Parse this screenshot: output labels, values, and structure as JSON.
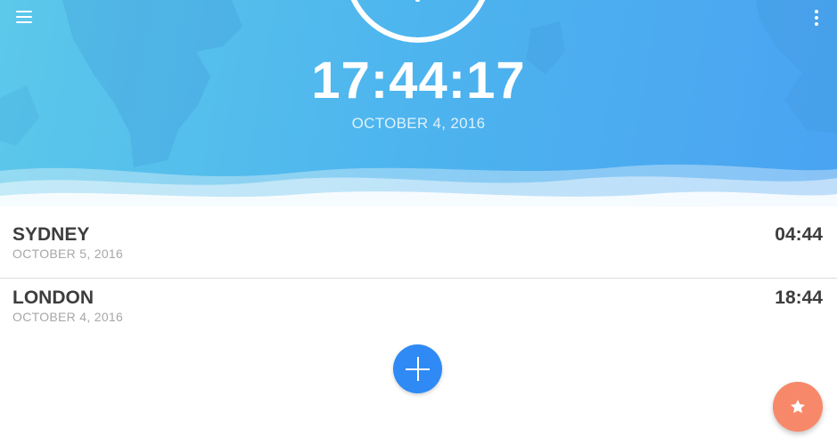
{
  "header": {
    "current_time": "17:44:17",
    "current_date": "OCTOBER 4, 2016",
    "menu_icon": "hamburger-menu-icon",
    "more_icon": "more-vertical-icon"
  },
  "cities": [
    {
      "name": "SYDNEY",
      "date": "OCTOBER 5, 2016",
      "time": "04:44"
    },
    {
      "name": "LONDON",
      "date": "OCTOBER 4, 2016",
      "time": "18:44"
    }
  ],
  "actions": {
    "add_icon": "plus-icon",
    "favorite_icon": "star-icon"
  },
  "colors": {
    "header_gradient_start": "#5cc8ea",
    "header_gradient_end": "#4aa3f2",
    "add_button": "#2f8af5",
    "favorite_button": "#f7896a",
    "primary_text": "#3d3d3d",
    "secondary_text": "#a7a7a7"
  }
}
